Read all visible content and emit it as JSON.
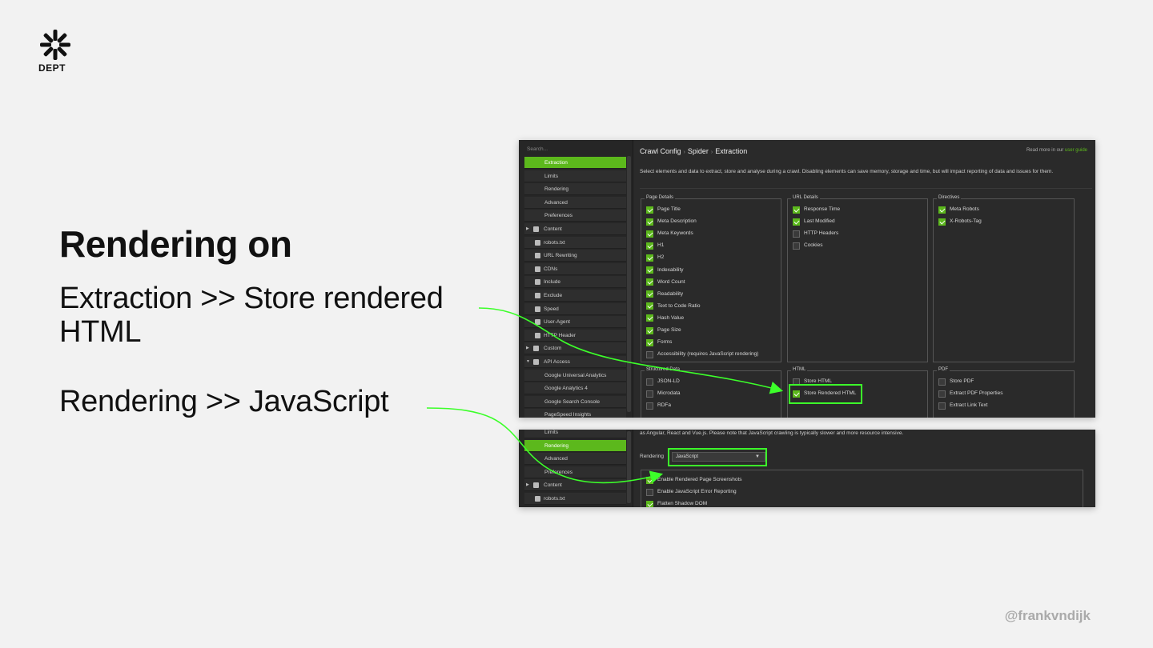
{
  "slide": {
    "logo_text": "DEPT",
    "title": "Rendering on",
    "step1": "Extraction >> Store rendered HTML",
    "step2": "Rendering >> JavaScript",
    "handle": "@frankvndijk"
  },
  "accent": "#5cb81c",
  "highlight": "#3cff2a",
  "shot1": {
    "search_placeholder": "Search...",
    "nav": [
      {
        "label": "Extraction",
        "active": true,
        "icon": null
      },
      {
        "label": "Limits",
        "active": false,
        "icon": null
      },
      {
        "label": "Rendering",
        "active": false,
        "icon": null
      },
      {
        "label": "Advanced",
        "active": false,
        "icon": null
      },
      {
        "label": "Preferences",
        "active": false,
        "icon": null
      },
      {
        "label": "Content",
        "active": false,
        "icon": "table-icon",
        "expandable": true
      },
      {
        "label": "robots.txt",
        "active": false,
        "icon": "robot-icon"
      },
      {
        "label": "URL Rewriting",
        "active": false,
        "icon": "edit-icon"
      },
      {
        "label": "CDNs",
        "active": false,
        "icon": "network-icon"
      },
      {
        "label": "Include",
        "active": false,
        "icon": "include-icon"
      },
      {
        "label": "Exclude",
        "active": false,
        "icon": "exclude-icon"
      },
      {
        "label": "Speed",
        "active": false,
        "icon": "speed-icon"
      },
      {
        "label": "User-Agent",
        "active": false,
        "icon": "user-icon"
      },
      {
        "label": "HTTP Header",
        "active": false,
        "icon": "header-icon"
      },
      {
        "label": "Custom",
        "active": false,
        "icon": "custom-icon",
        "expandable": true
      },
      {
        "label": "API Access",
        "active": false,
        "icon": "api-icon",
        "expanded": true
      },
      {
        "label": "Google Universal Analytics",
        "active": false,
        "icon": null
      },
      {
        "label": "Google Analytics 4",
        "active": false,
        "icon": null
      },
      {
        "label": "Google Search Console",
        "active": false,
        "icon": null
      },
      {
        "label": "PageSpeed Insights",
        "active": false,
        "icon": null
      }
    ],
    "breadcrumb": [
      "Crawl Config",
      "Spider",
      "Extraction"
    ],
    "read_more": "Read more in our",
    "read_more_link": "user guide",
    "description": "Select elements and data to extract, store and analyse during a crawl. Disabling elements can save memory, storage and time, but will impact reporting of data and issues for them.",
    "groups": {
      "page_details": {
        "legend": "Page Details",
        "items": [
          {
            "label": "Page Title",
            "checked": true
          },
          {
            "label": "Meta Description",
            "checked": true
          },
          {
            "label": "Meta Keywords",
            "checked": true
          },
          {
            "label": "H1",
            "checked": true
          },
          {
            "label": "H2",
            "checked": true
          },
          {
            "label": "Indexability",
            "checked": true
          },
          {
            "label": "Word Count",
            "checked": true
          },
          {
            "label": "Readability",
            "checked": true
          },
          {
            "label": "Text to Code Ratio",
            "checked": true
          },
          {
            "label": "Hash Value",
            "checked": true
          },
          {
            "label": "Page Size",
            "checked": true
          },
          {
            "label": "Forms",
            "checked": true
          },
          {
            "label": "Accessibility (requires JavaScript rendering)",
            "checked": false
          }
        ]
      },
      "url_details": {
        "legend": "URL Details",
        "items": [
          {
            "label": "Response Time",
            "checked": true
          },
          {
            "label": "Last Modified",
            "checked": true
          },
          {
            "label": "HTTP Headers",
            "checked": false
          },
          {
            "label": "Cookies",
            "checked": false
          }
        ]
      },
      "directives": {
        "legend": "Directives",
        "items": [
          {
            "label": "Meta Robots",
            "checked": true
          },
          {
            "label": "X-Robots-Tag",
            "checked": true
          }
        ]
      },
      "structured_data": {
        "legend": "Structured Data",
        "items": [
          {
            "label": "JSON-LD",
            "checked": false
          },
          {
            "label": "Microdata",
            "checked": false
          },
          {
            "label": "RDFa",
            "checked": false
          }
        ]
      },
      "html": {
        "legend": "HTML",
        "items": [
          {
            "label": "Store HTML",
            "checked": false
          },
          {
            "label": "Store Rendered HTML",
            "checked": true
          }
        ]
      },
      "pdf": {
        "legend": "PDF",
        "items": [
          {
            "label": "Store PDF",
            "checked": false
          },
          {
            "label": "Extract PDF Properties",
            "checked": false
          },
          {
            "label": "Extract Link Text",
            "checked": false
          }
        ]
      }
    }
  },
  "shot2": {
    "nav": [
      {
        "label": "Limits",
        "active": false,
        "icon": null
      },
      {
        "label": "Rendering",
        "active": true,
        "icon": null
      },
      {
        "label": "Advanced",
        "active": false,
        "icon": null
      },
      {
        "label": "Preferences",
        "active": false,
        "icon": null
      },
      {
        "label": "Content",
        "active": false,
        "icon": "table-icon",
        "expandable": true
      },
      {
        "label": "robots.txt",
        "active": false,
        "icon": "robot-icon"
      }
    ],
    "description": "as Angular, React and Vue.js. Please note that JavaScript crawling is typically slower and more resource intensive.",
    "rendering_label": "Rendering",
    "rendering_value": "JavaScript",
    "options": [
      {
        "label": "Enable Rendered Page Screenshots",
        "checked": true
      },
      {
        "label": "Enable JavaScript Error Reporting",
        "checked": false
      },
      {
        "label": "Flatten Shadow DOM",
        "checked": true
      }
    ]
  }
}
